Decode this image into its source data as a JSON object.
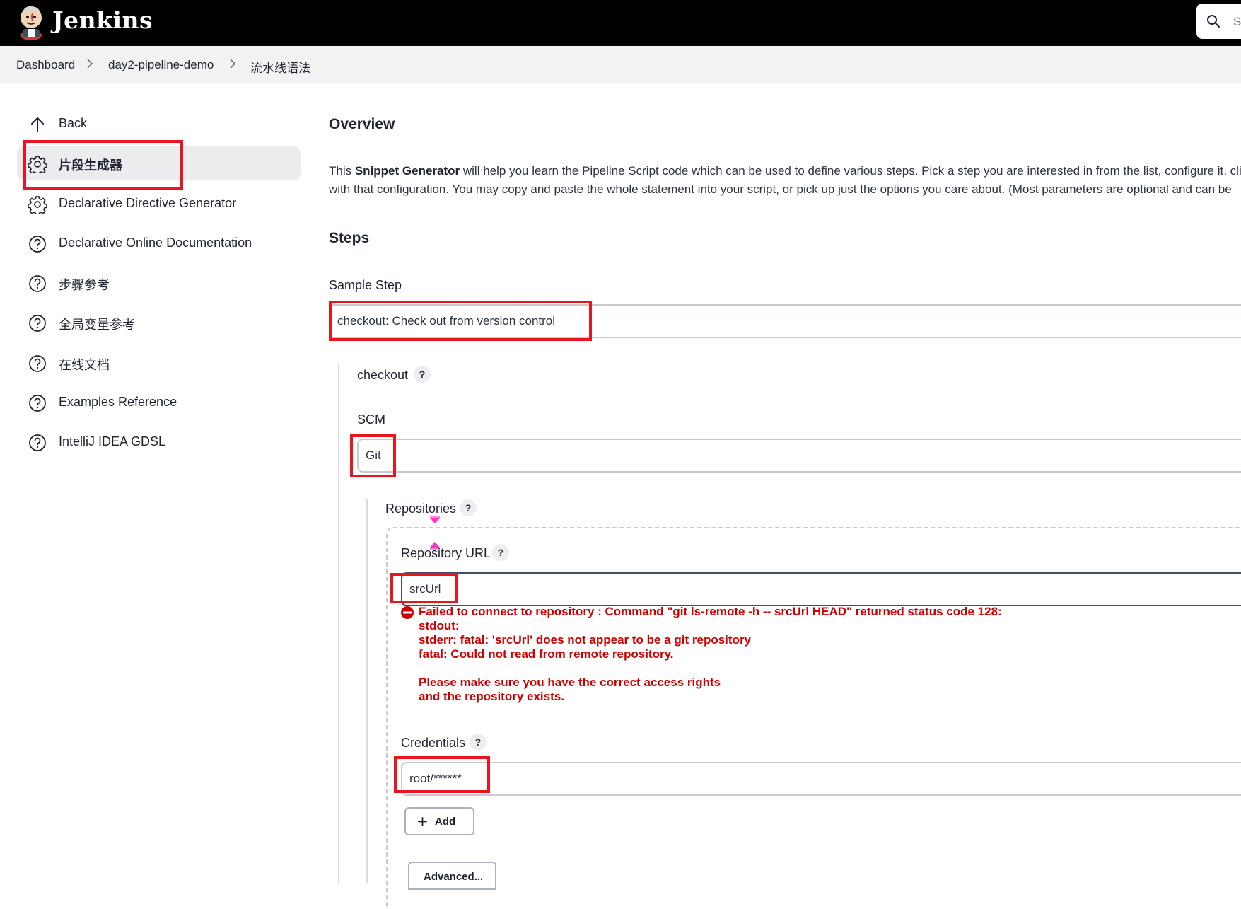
{
  "header": {
    "brand": "Jenkins",
    "search_placeholder": "S"
  },
  "breadcrumb": [
    "Dashboard",
    "day2-pipeline-demo",
    "流水线语法"
  ],
  "sidebar": {
    "items": [
      {
        "label": "Back",
        "icon": "arrow-up-icon"
      },
      {
        "label": "片段生成器",
        "icon": "gear-icon",
        "active": true
      },
      {
        "label": "Declarative Directive Generator",
        "icon": "gear-icon"
      },
      {
        "label": "Declarative Online Documentation",
        "icon": "help-circle-icon"
      },
      {
        "label": "步骤参考",
        "icon": "help-circle-icon"
      },
      {
        "label": "全局变量参考",
        "icon": "help-circle-icon"
      },
      {
        "label": "在线文档",
        "icon": "help-circle-icon"
      },
      {
        "label": "Examples Reference",
        "icon": "help-circle-icon"
      },
      {
        "label": "IntelliJ IDEA GDSL",
        "icon": "help-circle-icon"
      }
    ]
  },
  "main": {
    "overview_title": "Overview",
    "overview_line1_pre": "This ",
    "overview_line1_bold": "Snippet Generator",
    "overview_line1_post": " will help you learn the Pipeline Script code which can be used to define various steps. Pick a step you are interested in from the list, configure it, clic",
    "overview_line2": "with that configuration. You may copy and paste the whole statement into your script, or pick up just the options you care about. (Most parameters are optional and can be",
    "steps_title": "Steps",
    "sample_step_label": "Sample Step",
    "sample_step_value": "checkout: Check out from version control",
    "checkout_label": "checkout",
    "scm_label": "SCM",
    "scm_value": "Git",
    "repositories_label": "Repositories",
    "repo_url_label": "Repository URL",
    "repo_url_value": "srcUrl",
    "error_message": "Failed to connect to repository : Command \"git ls-remote -h -- srcUrl HEAD\" returned status code 128:\nstdout: \nstderr: fatal: 'srcUrl' does not appear to be a git repository\nfatal: Could not read from remote repository.\n\nPlease make sure you have the correct access rights\nand the repository exists.",
    "credentials_label": "Credentials",
    "credentials_value": "root/******",
    "add_button": "Add",
    "advanced_button": "Advanced...",
    "help_glyph": "?"
  },
  "colors": {
    "header_bg": "#000000",
    "error": "#cc0000",
    "highlight_box": "#e8151f"
  }
}
